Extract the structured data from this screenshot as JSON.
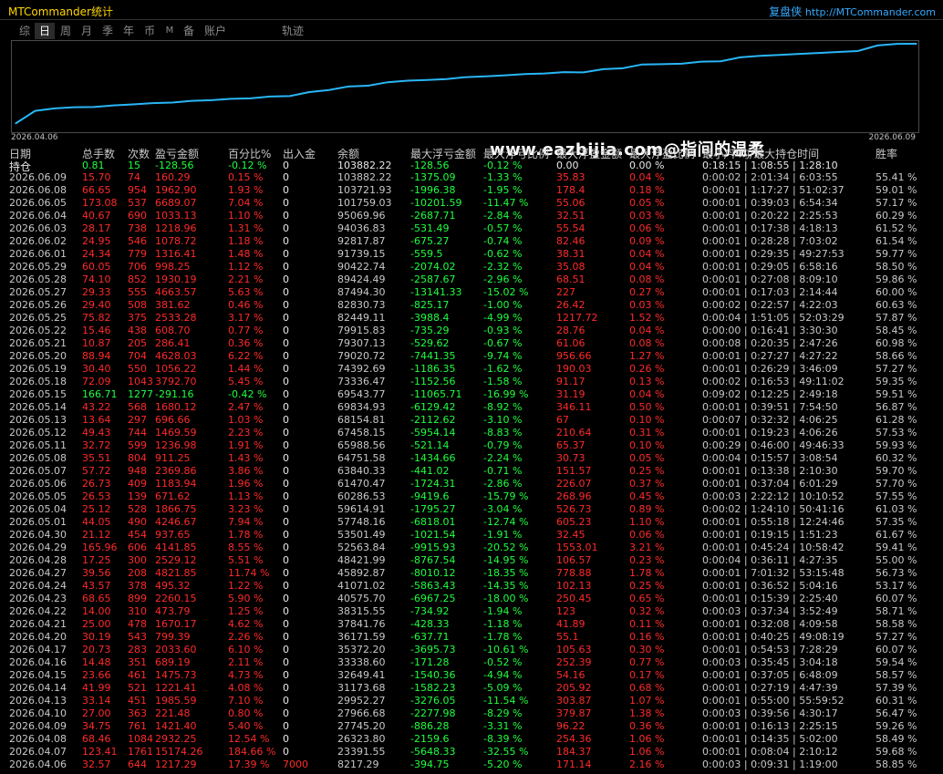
{
  "app": {
    "title": "MTCommander统计",
    "brand": "复盘侠",
    "url": "http://MTCommander.com"
  },
  "tabs": [
    "综",
    "日",
    "周",
    "月",
    "季",
    "年",
    "币",
    "M",
    "备",
    "账户",
    "轨迹"
  ],
  "active_tab": "日",
  "chart": {
    "start_label": "2026.04.06",
    "end_label": "2026.06.09",
    "line_color": "#29b6f6"
  },
  "chart_data": {
    "type": "line",
    "x": [
      "2026.04.06",
      "2026.04.07",
      "2026.04.08",
      "2026.04.09",
      "2026.04.10",
      "2026.04.13",
      "2026.04.14",
      "2026.04.15",
      "2026.04.16",
      "2026.04.17",
      "2026.04.20",
      "2026.04.21",
      "2026.04.22",
      "2026.04.23",
      "2026.04.24",
      "2026.04.27",
      "2026.04.28",
      "2026.04.29",
      "2026.04.30",
      "2026.05.01",
      "2026.05.04",
      "2026.05.05",
      "2026.05.06",
      "2026.05.07",
      "2026.05.08",
      "2026.05.11",
      "2026.05.12",
      "2026.05.13",
      "2026.05.14",
      "2026.05.15",
      "2026.05.18",
      "2026.05.19",
      "2026.05.20",
      "2026.05.21",
      "2026.05.22",
      "2026.05.25",
      "2026.05.26",
      "2026.05.27",
      "2026.05.28",
      "2026.05.29",
      "2026.06.01",
      "2026.06.02",
      "2026.06.03",
      "2026.06.04",
      "2026.06.05",
      "2026.06.08",
      "2026.06.09"
    ],
    "values": [
      8217.29,
      23391.55,
      26323.8,
      27745.2,
      27966.68,
      29952.27,
      31173.68,
      32649.41,
      33338.6,
      35372.2,
      36171.59,
      37841.76,
      38315.55,
      40575.7,
      41071.02,
      45892.87,
      48421.99,
      52563.84,
      53501.49,
      57748.16,
      59614.91,
      60286.53,
      61470.47,
      63840.33,
      64751.58,
      65988.56,
      67458.15,
      68154.81,
      69834.93,
      69543.77,
      73336.47,
      74392.69,
      79020.72,
      79307.13,
      79915.83,
      82449.11,
      82830.73,
      87494.3,
      89424.49,
      90422.74,
      91739.15,
      92817.87,
      94036.83,
      95069.96,
      101759.03,
      103721.93,
      103882.22
    ]
  },
  "watermark": "www.eazbijia.com@指间的温柔",
  "headers": {
    "date": "日期",
    "n": "总手数",
    "cnt": "次数",
    "pnl": "盈亏金额",
    "pct": "百分比%",
    "io": "出入金",
    "bal": "余额",
    "mf": "最大浮亏金额",
    "mfp": "最大浮亏比例",
    "mg": "最大浮盈金额",
    "mgp": "最大浮盈比例",
    "time": "最小/平均/最大持仓时间",
    "win": "胜率"
  },
  "pos_row": {
    "label": "持仓",
    "n": "0.81",
    "cnt": "15",
    "pnl": "-128.56",
    "pct": "-0.12 %",
    "io": "0",
    "bal": "103882.22",
    "mf": "-128.56",
    "mfp": "-0.12 %",
    "mg": "0.00",
    "mgp": "0.00 %",
    "time": "0:18:15 | 1:08:55 | 1:28:10"
  },
  "rows": [
    {
      "d": "2026.06.09",
      "n": "15.70",
      "c": "74",
      "p": "160.29",
      "pc": "0.15 %",
      "io": "0",
      "b": "103882.22",
      "mf": "-1375.09",
      "mfp": "-1.33 %",
      "mg": "35.83",
      "mgp": "0.04 %",
      "t": "0:00:02 | 2:01:34 | 6:03:55",
      "w": "55.41 %"
    },
    {
      "d": "2026.06.08",
      "n": "66.65",
      "c": "954",
      "p": "1962.90",
      "pc": "1.93 %",
      "io": "0",
      "b": "103721.93",
      "mf": "-1996.38",
      "mfp": "-1.95 %",
      "mg": "178.4",
      "mgp": "0.18 %",
      "t": "0:00:01 | 1:17:27 | 51:02:37",
      "w": "59.01 %"
    },
    {
      "d": "2026.06.05",
      "n": "173.08",
      "c": "537",
      "p": "6689.07",
      "pc": "7.04 %",
      "io": "0",
      "b": "101759.03",
      "mf": "-10201.59",
      "mfp": "-11.47 %",
      "mg": "55.06",
      "mgp": "0.05 %",
      "t": "0:00:01 | 0:39:03 | 6:54:34",
      "w": "57.17 %"
    },
    {
      "d": "2026.06.04",
      "n": "40.67",
      "c": "690",
      "p": "1033.13",
      "pc": "1.10 %",
      "io": "0",
      "b": "95069.96",
      "mf": "-2687.71",
      "mfp": "-2.84 %",
      "mg": "32.51",
      "mgp": "0.03 %",
      "t": "0:00:01 | 0:20:22 | 2:25:53",
      "w": "60.29 %"
    },
    {
      "d": "2026.06.03",
      "n": "28.17",
      "c": "738",
      "p": "1218.96",
      "pc": "1.31 %",
      "io": "0",
      "b": "94036.83",
      "mf": "-531.49",
      "mfp": "-0.57 %",
      "mg": "55.54",
      "mgp": "0.06 %",
      "t": "0:00:01 | 0:17:38 | 4:18:13",
      "w": "61.52 %"
    },
    {
      "d": "2026.06.02",
      "n": "24.95",
      "c": "546",
      "p": "1078.72",
      "pc": "1.18 %",
      "io": "0",
      "b": "92817.87",
      "mf": "-675.27",
      "mfp": "-0.74 %",
      "mg": "82.46",
      "mgp": "0.09 %",
      "t": "0:00:01 | 0:28:28 | 7:03:02",
      "w": "61.54 %"
    },
    {
      "d": "2026.06.01",
      "n": "24.34",
      "c": "779",
      "p": "1316.41",
      "pc": "1.48 %",
      "io": "0",
      "b": "91739.15",
      "mf": "-559.5",
      "mfp": "-0.62 %",
      "mg": "38.31",
      "mgp": "0.04 %",
      "t": "0:00:01 | 0:29:35 | 49:27:53",
      "w": "59.77 %"
    },
    {
      "d": "2026.05.29",
      "n": "60.05",
      "c": "706",
      "p": "998.25",
      "pc": "1.12 %",
      "io": "0",
      "b": "90422.74",
      "mf": "-2074.02",
      "mfp": "-2.32 %",
      "mg": "35.08",
      "mgp": "0.04 %",
      "t": "0:00:01 | 0:29:05 | 6:58:16",
      "w": "58.50 %"
    },
    {
      "d": "2026.05.28",
      "n": "74.10",
      "c": "852",
      "p": "1930.19",
      "pc": "2.21 %",
      "io": "0",
      "b": "89424.49",
      "mf": "-2587.67",
      "mfp": "-2.96 %",
      "mg": "68.51",
      "mgp": "0.08 %",
      "t": "0:00:01 | 0:27:08 | 8:09:10",
      "w": "59.86 %"
    },
    {
      "d": "2026.05.27",
      "n": "29.33",
      "c": "555",
      "p": "4663.57",
      "pc": "5.63 %",
      "io": "0",
      "b": "87494.30",
      "mf": "-13141.33",
      "mfp": "-15.02 %",
      "mg": "227",
      "mgp": "0.27 %",
      "t": "0:00:01 | 0:17:03 | 2:14:44",
      "w": "60.00 %"
    },
    {
      "d": "2026.05.26",
      "n": "29.40",
      "c": "508",
      "p": "381.62",
      "pc": "0.46 %",
      "io": "0",
      "b": "82830.73",
      "mf": "-825.17",
      "mfp": "-1.00 %",
      "mg": "26.42",
      "mgp": "0.03 %",
      "t": "0:00:02 | 0:22:57 | 4:22:03",
      "w": "60.63 %"
    },
    {
      "d": "2026.05.25",
      "n": "75.82",
      "c": "375",
      "p": "2533.28",
      "pc": "3.17 %",
      "io": "0",
      "b": "82449.11",
      "mf": "-3988.4",
      "mfp": "-4.99 %",
      "mg": "1217.72",
      "mgp": "1.52 %",
      "t": "0:00:04 | 1:51:05 | 52:03:29",
      "w": "57.87 %"
    },
    {
      "d": "2026.05.22",
      "n": "15.46",
      "c": "438",
      "p": "608.70",
      "pc": "0.77 %",
      "io": "0",
      "b": "79915.83",
      "mf": "-735.29",
      "mfp": "-0.93 %",
      "mg": "28.76",
      "mgp": "0.04 %",
      "t": "0:00:00 | 0:16:41 | 3:30:30",
      "w": "58.45 %"
    },
    {
      "d": "2026.05.21",
      "n": "10.87",
      "c": "205",
      "p": "286.41",
      "pc": "0.36 %",
      "io": "0",
      "b": "79307.13",
      "mf": "-529.62",
      "mfp": "-0.67 %",
      "mg": "61.06",
      "mgp": "0.08 %",
      "t": "0:00:08 | 0:20:35 | 2:47:26",
      "w": "60.98 %"
    },
    {
      "d": "2026.05.20",
      "n": "88.94",
      "c": "704",
      "p": "4628.03",
      "pc": "6.22 %",
      "io": "0",
      "b": "79020.72",
      "mf": "-7441.35",
      "mfp": "-9.74 %",
      "mg": "956.66",
      "mgp": "1.27 %",
      "t": "0:00:01 | 0:27:27 | 4:27:22",
      "w": "58.66 %"
    },
    {
      "d": "2026.05.19",
      "n": "30.40",
      "c": "550",
      "p": "1056.22",
      "pc": "1.44 %",
      "io": "0",
      "b": "74392.69",
      "mf": "-1186.35",
      "mfp": "-1.62 %",
      "mg": "190.03",
      "mgp": "0.26 %",
      "t": "0:00:01 | 0:26:29 | 3:46:09",
      "w": "57.27 %"
    },
    {
      "d": "2026.05.18",
      "n": "72.09",
      "c": "1043",
      "p": "3792.70",
      "pc": "5.45 %",
      "io": "0",
      "b": "73336.47",
      "mf": "-1152.56",
      "mfp": "-1.58 %",
      "mg": "91.17",
      "mgp": "0.13 %",
      "t": "0:00:02 | 0:16:53 | 49:11:02",
      "w": "59.35 %"
    },
    {
      "d": "2026.05.15",
      "n": "166.71",
      "c": "1277",
      "p": "-291.16",
      "pc": "-0.42 %",
      "io": "0",
      "b": "69543.77",
      "mf": "-11065.71",
      "mfp": "-16.99 %",
      "mg": "31.19",
      "mgp": "0.04 %",
      "t": "0:09:02 | 0:12:25 | 2:49:18",
      "w": "59.51 %"
    },
    {
      "d": "2026.05.14",
      "n": "43.22",
      "c": "568",
      "p": "1680.12",
      "pc": "2.47 %",
      "io": "0",
      "b": "69834.93",
      "mf": "-6129.42",
      "mfp": "-8.92 %",
      "mg": "346.11",
      "mgp": "0.50 %",
      "t": "0:00:01 | 0:39:51 | 7:54:50",
      "w": "56.87 %"
    },
    {
      "d": "2026.05.13",
      "n": "13.64",
      "c": "297",
      "p": "696.66",
      "pc": "1.03 %",
      "io": "0",
      "b": "68154.81",
      "mf": "-2112.62",
      "mfp": "-3.10 %",
      "mg": "67",
      "mgp": "0.10 %",
      "t": "0:00:07 | 0:32:32 | 4:06:25",
      "w": "61.28 %"
    },
    {
      "d": "2026.05.12",
      "n": "49.43",
      "c": "744",
      "p": "1469.59",
      "pc": "2.23 %",
      "io": "0",
      "b": "67458.15",
      "mf": "-5954.14",
      "mfp": "-8.83 %",
      "mg": "210.64",
      "mgp": "0.31 %",
      "t": "0:00:01 | 0:19:23 | 4:06:26",
      "w": "57.53 %"
    },
    {
      "d": "2026.05.11",
      "n": "32.72",
      "c": "599",
      "p": "1236.98",
      "pc": "1.91 %",
      "io": "0",
      "b": "65988.56",
      "mf": "-521.14",
      "mfp": "-0.79 %",
      "mg": "65.37",
      "mgp": "0.10 %",
      "t": "0:00:29 | 0:46:00 | 49:46:33",
      "w": "59.93 %"
    },
    {
      "d": "2026.05.08",
      "n": "35.51",
      "c": "804",
      "p": "911.25",
      "pc": "1.43 %",
      "io": "0",
      "b": "64751.58",
      "mf": "-1434.66",
      "mfp": "-2.24 %",
      "mg": "30.73",
      "mgp": "0.05 %",
      "t": "0:00:04 | 0:15:57 | 3:08:54",
      "w": "60.32 %"
    },
    {
      "d": "2026.05.07",
      "n": "57.72",
      "c": "948",
      "p": "2369.86",
      "pc": "3.86 %",
      "io": "0",
      "b": "63840.33",
      "mf": "-441.02",
      "mfp": "-0.71 %",
      "mg": "151.57",
      "mgp": "0.25 %",
      "t": "0:00:01 | 0:13:38 | 2:10:30",
      "w": "59.70 %"
    },
    {
      "d": "2026.05.06",
      "n": "26.73",
      "c": "409",
      "p": "1183.94",
      "pc": "1.96 %",
      "io": "0",
      "b": "61470.47",
      "mf": "-1724.31",
      "mfp": "-2.86 %",
      "mg": "226.07",
      "mgp": "0.37 %",
      "t": "0:00:01 | 0:37:04 | 6:01:29",
      "w": "57.70 %"
    },
    {
      "d": "2026.05.05",
      "n": "26.53",
      "c": "139",
      "p": "671.62",
      "pc": "1.13 %",
      "io": "0",
      "b": "60286.53",
      "mf": "-9419.6",
      "mfp": "-15.79 %",
      "mg": "268.96",
      "mgp": "0.45 %",
      "t": "0:00:03 | 2:22:12 | 10:10:52",
      "w": "57.55 %"
    },
    {
      "d": "2026.05.04",
      "n": "25.12",
      "c": "528",
      "p": "1866.75",
      "pc": "3.23 %",
      "io": "0",
      "b": "59614.91",
      "mf": "-1795.27",
      "mfp": "-3.04 %",
      "mg": "526.73",
      "mgp": "0.89 %",
      "t": "0:00:02 | 1:24:10 | 50:41:16",
      "w": "61.03 %"
    },
    {
      "d": "2026.05.01",
      "n": "44.05",
      "c": "490",
      "p": "4246.67",
      "pc": "7.94 %",
      "io": "0",
      "b": "57748.16",
      "mf": "-6818.01",
      "mfp": "-12.74 %",
      "mg": "605.23",
      "mgp": "1.10 %",
      "t": "0:00:01 | 0:55:18 | 12:24:46",
      "w": "57.35 %"
    },
    {
      "d": "2026.04.30",
      "n": "21.12",
      "c": "454",
      "p": "937.65",
      "pc": "1.78 %",
      "io": "0",
      "b": "53501.49",
      "mf": "-1021.54",
      "mfp": "-1.91 %",
      "mg": "32.45",
      "mgp": "0.06 %",
      "t": "0:00:01 | 0:19:15 | 1:51:23",
      "w": "61.67 %"
    },
    {
      "d": "2026.04.29",
      "n": "165.96",
      "c": "606",
      "p": "4141.85",
      "pc": "8.55 %",
      "io": "0",
      "b": "52563.84",
      "mf": "-9915.93",
      "mfp": "-20.52 %",
      "mg": "1553.01",
      "mgp": "3.21 %",
      "t": "0:00:01 | 0:45:24 | 10:58:42",
      "w": "59.41 %"
    },
    {
      "d": "2026.04.28",
      "n": "17.25",
      "c": "300",
      "p": "2529.12",
      "pc": "5.51 %",
      "io": "0",
      "b": "48421.99",
      "mf": "-8767.54",
      "mfp": "-14.95 %",
      "mg": "106.57",
      "mgp": "0.23 %",
      "t": "0:00:04 | 0:36:11 | 4:27:35",
      "w": "55.00 %"
    },
    {
      "d": "2026.04.27",
      "n": "39.56",
      "c": "208",
      "p": "4821.85",
      "pc": "11.74 %",
      "io": "0",
      "b": "45892.87",
      "mf": "-8010.12",
      "mfp": "-18.35 %",
      "mg": "778.88",
      "mgp": "1.78 %",
      "t": "0:00:01 | 7:01:32 | 53:15:48",
      "w": "56.73 %"
    },
    {
      "d": "2026.04.24",
      "n": "43.57",
      "c": "378",
      "p": "495.32",
      "pc": "1.22 %",
      "io": "0",
      "b": "41071.02",
      "mf": "-5863.43",
      "mfp": "-14.35 %",
      "mg": "102.13",
      "mgp": "0.25 %",
      "t": "0:00:01 | 0:36:52 | 5:04:16",
      "w": "53.17 %"
    },
    {
      "d": "2026.04.23",
      "n": "68.65",
      "c": "899",
      "p": "2260.15",
      "pc": "5.90 %",
      "io": "0",
      "b": "40575.70",
      "mf": "-6967.25",
      "mfp": "-18.00 %",
      "mg": "250.45",
      "mgp": "0.65 %",
      "t": "0:00:01 | 0:15:39 | 2:25:40",
      "w": "60.07 %"
    },
    {
      "d": "2026.04.22",
      "n": "14.00",
      "c": "310",
      "p": "473.79",
      "pc": "1.25 %",
      "io": "0",
      "b": "38315.55",
      "mf": "-734.92",
      "mfp": "-1.94 %",
      "mg": "123",
      "mgp": "0.32 %",
      "t": "0:00:03 | 0:37:34 | 3:52:49",
      "w": "58.71 %"
    },
    {
      "d": "2026.04.21",
      "n": "25.00",
      "c": "478",
      "p": "1670.17",
      "pc": "4.62 %",
      "io": "0",
      "b": "37841.76",
      "mf": "-428.33",
      "mfp": "-1.18 %",
      "mg": "41.89",
      "mgp": "0.11 %",
      "t": "0:00:01 | 0:32:08 | 4:09:58",
      "w": "58.58 %"
    },
    {
      "d": "2026.04.20",
      "n": "30.19",
      "c": "543",
      "p": "799.39",
      "pc": "2.26 %",
      "io": "0",
      "b": "36171.59",
      "mf": "-637.71",
      "mfp": "-1.78 %",
      "mg": "55.1",
      "mgp": "0.16 %",
      "t": "0:00:01 | 0:40:25 | 49:08:19",
      "w": "57.27 %"
    },
    {
      "d": "2026.04.17",
      "n": "20.73",
      "c": "283",
      "p": "2033.60",
      "pc": "6.10 %",
      "io": "0",
      "b": "35372.20",
      "mf": "-3695.73",
      "mfp": "-10.61 %",
      "mg": "105.63",
      "mgp": "0.30 %",
      "t": "0:00:01 | 0:54:53 | 7:28:29",
      "w": "60.07 %"
    },
    {
      "d": "2026.04.16",
      "n": "14.48",
      "c": "351",
      "p": "689.19",
      "pc": "2.11 %",
      "io": "0",
      "b": "33338.60",
      "mf": "-171.28",
      "mfp": "-0.52 %",
      "mg": "252.39",
      "mgp": "0.77 %",
      "t": "0:00:03 | 0:35:45 | 3:04:18",
      "w": "59.54 %"
    },
    {
      "d": "2026.04.15",
      "n": "23.66",
      "c": "461",
      "p": "1475.73",
      "pc": "4.73 %",
      "io": "0",
      "b": "32649.41",
      "mf": "-1540.36",
      "mfp": "-4.94 %",
      "mg": "54.16",
      "mgp": "0.17 %",
      "t": "0:00:01 | 0:37:05 | 6:48:09",
      "w": "58.57 %"
    },
    {
      "d": "2026.04.14",
      "n": "41.99",
      "c": "521",
      "p": "1221.41",
      "pc": "4.08 %",
      "io": "0",
      "b": "31173.68",
      "mf": "-1582.23",
      "mfp": "-5.09 %",
      "mg": "205.92",
      "mgp": "0.68 %",
      "t": "0:00:01 | 0:27:19 | 4:47:39",
      "w": "57.39 %"
    },
    {
      "d": "2026.04.13",
      "n": "33.14",
      "c": "451",
      "p": "1985.59",
      "pc": "7.10 %",
      "io": "0",
      "b": "29952.27",
      "mf": "-3276.05",
      "mfp": "-11.54 %",
      "mg": "303.87",
      "mgp": "1.07 %",
      "t": "0:00:01 | 0:55:00 | 55:59:52",
      "w": "60.31 %"
    },
    {
      "d": "2026.04.10",
      "n": "27.00",
      "c": "363",
      "p": "221.48",
      "pc": "0.80 %",
      "io": "0",
      "b": "27966.68",
      "mf": "-2277.98",
      "mfp": "-8.29 %",
      "mg": "379.87",
      "mgp": "1.38 %",
      "t": "0:00:03 | 0:39:56 | 4:30:17",
      "w": "56.47 %"
    },
    {
      "d": "2026.04.09",
      "n": "34.75",
      "c": "761",
      "p": "1421.40",
      "pc": "5.40 %",
      "io": "0",
      "b": "27745.20",
      "mf": "-886.28",
      "mfp": "-3.31 %",
      "mg": "96.22",
      "mgp": "0.36 %",
      "t": "0:00:01 | 0:16:13 | 2:25:15",
      "w": "59.26 %"
    },
    {
      "d": "2026.04.08",
      "n": "68.46",
      "c": "1084",
      "p": "2932.25",
      "pc": "12.54 %",
      "io": "0",
      "b": "26323.80",
      "mf": "-2159.6",
      "mfp": "-8.39 %",
      "mg": "254.36",
      "mgp": "1.06 %",
      "t": "0:00:01 | 0:14:35 | 5:02:00",
      "w": "58.49 %"
    },
    {
      "d": "2026.04.07",
      "n": "123.41",
      "c": "1761",
      "p": "15174.26",
      "pc": "184.66 %",
      "io": "0",
      "b": "23391.55",
      "mf": "-5648.33",
      "mfp": "-32.55 %",
      "mg": "184.37",
      "mgp": "1.06 %",
      "t": "0:00:01 | 0:08:04 | 2:10:12",
      "w": "59.68 %"
    },
    {
      "d": "2026.04.06",
      "n": "32.57",
      "c": "644",
      "p": "1217.29",
      "pc": "17.39 %",
      "io": "7000",
      "b": "8217.29",
      "mf": "-394.75",
      "mfp": "-5.20 %",
      "mg": "171.14",
      "mgp": "2.16 %",
      "t": "0:00:03 | 0:09:31 | 1:19:00",
      "w": "58.85 %"
    }
  ]
}
